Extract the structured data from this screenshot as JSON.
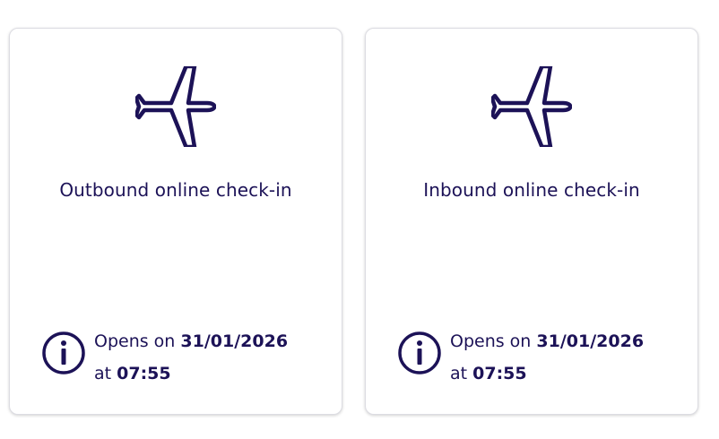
{
  "colors": {
    "primary_text": "#1c1257",
    "card_border": "#dcdce2",
    "background": "#ffffff"
  },
  "cards": [
    {
      "icon": "airplane-icon",
      "title": "Outbound online check-in",
      "info_icon": "info-circle-icon",
      "opens_prefix": "Opens on",
      "opens_date": "31/01/2026",
      "at_prefix": "at",
      "opens_time": "07:55"
    },
    {
      "icon": "airplane-icon",
      "title": "Inbound online check-in",
      "info_icon": "info-circle-icon",
      "opens_prefix": "Opens on",
      "opens_date": "31/01/2026",
      "at_prefix": "at",
      "opens_time": "07:55"
    }
  ]
}
